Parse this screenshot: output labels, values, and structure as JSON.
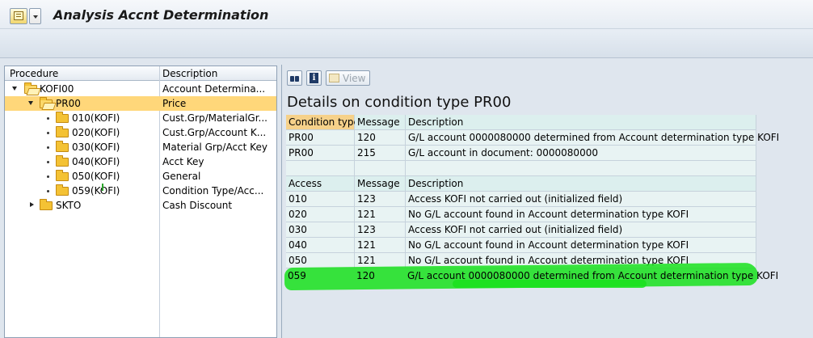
{
  "window": {
    "title": "Analysis Accnt Determination"
  },
  "tree": {
    "headers": {
      "procedure": "Procedure",
      "description": "Description"
    },
    "rows": [
      {
        "label": "KOFI00",
        "desc": "Account Determina..."
      },
      {
        "label": "PR00",
        "desc": "Price"
      },
      {
        "label": "010(KOFI)",
        "desc": "Cust.Grp/MaterialGr..."
      },
      {
        "label": "020(KOFI)",
        "desc": "Cust.Grp/Account K..."
      },
      {
        "label": "030(KOFI)",
        "desc": "Material Grp/Acct Key"
      },
      {
        "label": "040(KOFI)",
        "desc": "Acct Key"
      },
      {
        "label": "050(KOFI)",
        "desc": "General"
      },
      {
        "label": "059(KOFI)",
        "desc": "Condition Type/Acc..."
      },
      {
        "label": "SKTO",
        "desc": "Cash Discount"
      }
    ]
  },
  "detail": {
    "toolbar": {
      "view_label": "View"
    },
    "title": "Details on condition type PR00",
    "cond_headers": {
      "c1": "Condition type",
      "c2": "Message",
      "c3": "Description"
    },
    "cond_rows": [
      {
        "c1": "PR00",
        "c2": "120",
        "c3": "G/L account 0000080000 determined from Account determination type KOFI"
      },
      {
        "c1": "PR00",
        "c2": "215",
        "c3": "G/L account in document: 0000080000"
      }
    ],
    "access_headers": {
      "c1": "Access",
      "c2": "Message",
      "c3": "Description"
    },
    "access_rows": [
      {
        "c1": "010",
        "c2": "123",
        "c3": "Access KOFI not carried out (initialized field)"
      },
      {
        "c1": "020",
        "c2": "121",
        "c3": "No G/L account found in Account determination type KOFI"
      },
      {
        "c1": "030",
        "c2": "123",
        "c3": "Access KOFI not carried out (initialized field)"
      },
      {
        "c1": "040",
        "c2": "121",
        "c3": "No G/L account found in Account determination type KOFI"
      },
      {
        "c1": "050",
        "c2": "121",
        "c3": "No G/L account found in Account determination type KOFI"
      },
      {
        "c1": "059",
        "c2": "120",
        "c3": "G/L account 0000080000 determined from Account determination type KOFI"
      }
    ]
  },
  "colors": {
    "selection": "#ffd77a",
    "header": "#f6d18a",
    "highlighter": "#19e01c"
  }
}
